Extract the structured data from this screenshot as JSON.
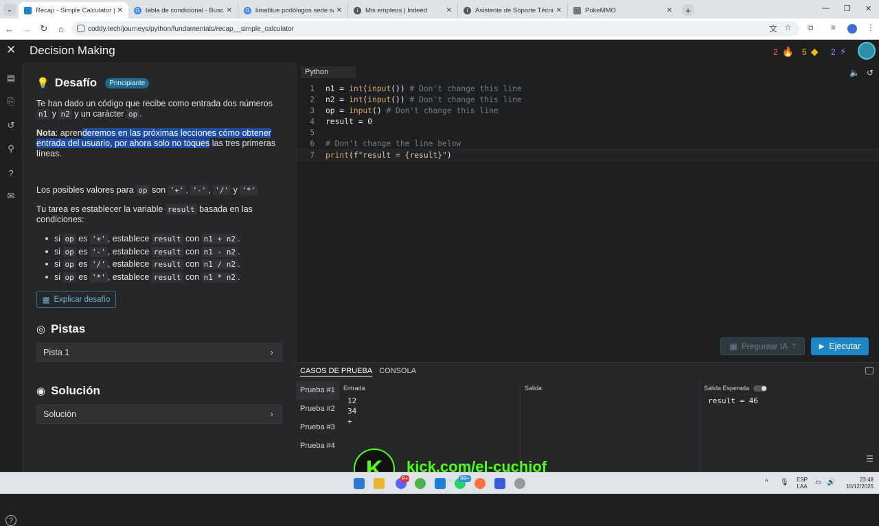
{
  "browser": {
    "tabs": [
      {
        "title": "Recap - Simple Calculator | Pyt",
        "active": true,
        "color": "#1c86c6"
      },
      {
        "title": "tabla de condicional - Buscar c",
        "active": false,
        "color": "#4285f4"
      },
      {
        "title": "limablue podólogos sede san n",
        "active": false,
        "color": "#4285f4"
      },
      {
        "title": "Mis empleos | Indeed",
        "active": false,
        "color": "#555555"
      },
      {
        "title": "Asistente de Soporte Técnico -",
        "active": false,
        "color": "#555555"
      },
      {
        "title": "PokeMMO",
        "active": false,
        "color": "#777777"
      }
    ],
    "url": "coddy.tech/journeys/python/fundamentals/recap__simple_calculator"
  },
  "app": {
    "title": "Decision Making",
    "stats": [
      {
        "value": "2",
        "icon": "fire-icon",
        "color": "#ff5a36"
      },
      {
        "value": "5",
        "icon": "gem-icon",
        "color": "#f5b800"
      },
      {
        "value": "2",
        "icon": "bolt-icon",
        "color": "#7c7cff"
      }
    ]
  },
  "challenge": {
    "title": "Desafío",
    "badge": "Principiante",
    "intro_a": "Te han dado un código que recibe como entrada dos números",
    "intro_n1": "n1",
    "intro_y": "y",
    "intro_n2": "n2",
    "intro_b": "y un carácter",
    "intro_op": "op",
    "intro_end": ".",
    "note_label": "Nota",
    "note_a": ": apren",
    "note_hl": "deremos en las próximas lecciones cómo obtener entrada del usuario, por ahora solo no toques",
    "note_b": " las tres primeras líneas.",
    "values_text": "Los posibles valores para",
    "values_op": "op",
    "values_son": "son",
    "values": [
      "'+'",
      "'-'",
      "'/'",
      "'*'"
    ],
    "values_and": "y",
    "task_a": "Tu tarea es establecer la variable",
    "task_var": "result",
    "task_b": "basada en las condiciones:",
    "rules": [
      {
        "op": "'+'",
        "expr": "n1 + n2"
      },
      {
        "op": "'-'",
        "expr": "n1 - n2"
      },
      {
        "op": "'/'",
        "expr": "n1 / n2"
      },
      {
        "op": "'*'",
        "expr": "n1 * n2"
      }
    ],
    "rule_si": "si",
    "rule_opvar": "op",
    "rule_es": "es",
    "rule_set": ", establece",
    "rule_result": "result",
    "rule_con": "con",
    "explain_label": "Explicar desafío"
  },
  "hints": {
    "title": "Pistas",
    "item": "Pista 1"
  },
  "solution": {
    "title": "Solución",
    "item": "Solución"
  },
  "editor": {
    "language": "Python",
    "lines": [
      {
        "n": "1",
        "code": "n1 = int(input()) # Don't change this line"
      },
      {
        "n": "2",
        "code": "n2 = int(input()) # Don't change this line"
      },
      {
        "n": "3",
        "code": "op = input() # Don't change this line"
      },
      {
        "n": "4",
        "code": "result = 0"
      },
      {
        "n": "5",
        "code": ""
      },
      {
        "n": "6",
        "code": "# Don't change the line below"
      },
      {
        "n": "7",
        "code": "print(f\"result = {result}\")"
      }
    ],
    "ask_ai": "Preguntar IA",
    "run": "Ejecutar"
  },
  "tests": {
    "tab_cases": "CASOS DE PRUEBA",
    "tab_console": "CONSOLA",
    "items": [
      "Prueba #1",
      "Prueba #2",
      "Prueba #3",
      "Prueba #4"
    ],
    "col_input": "Entrada",
    "col_output": "Salida",
    "col_expected": "Salida Esperada",
    "input_value": "12\n34\n+",
    "output_value": "",
    "expected_value": "result = 46"
  },
  "overlay": {
    "logo": "K",
    "text": "kick.com/el-cuchiof"
  },
  "taskbar": {
    "lang": "ESP",
    "lang2": "LAA",
    "time": "23:48",
    "date": "10/12/2025",
    "discord_badge": "9+",
    "whatsapp_badge": "99+"
  }
}
